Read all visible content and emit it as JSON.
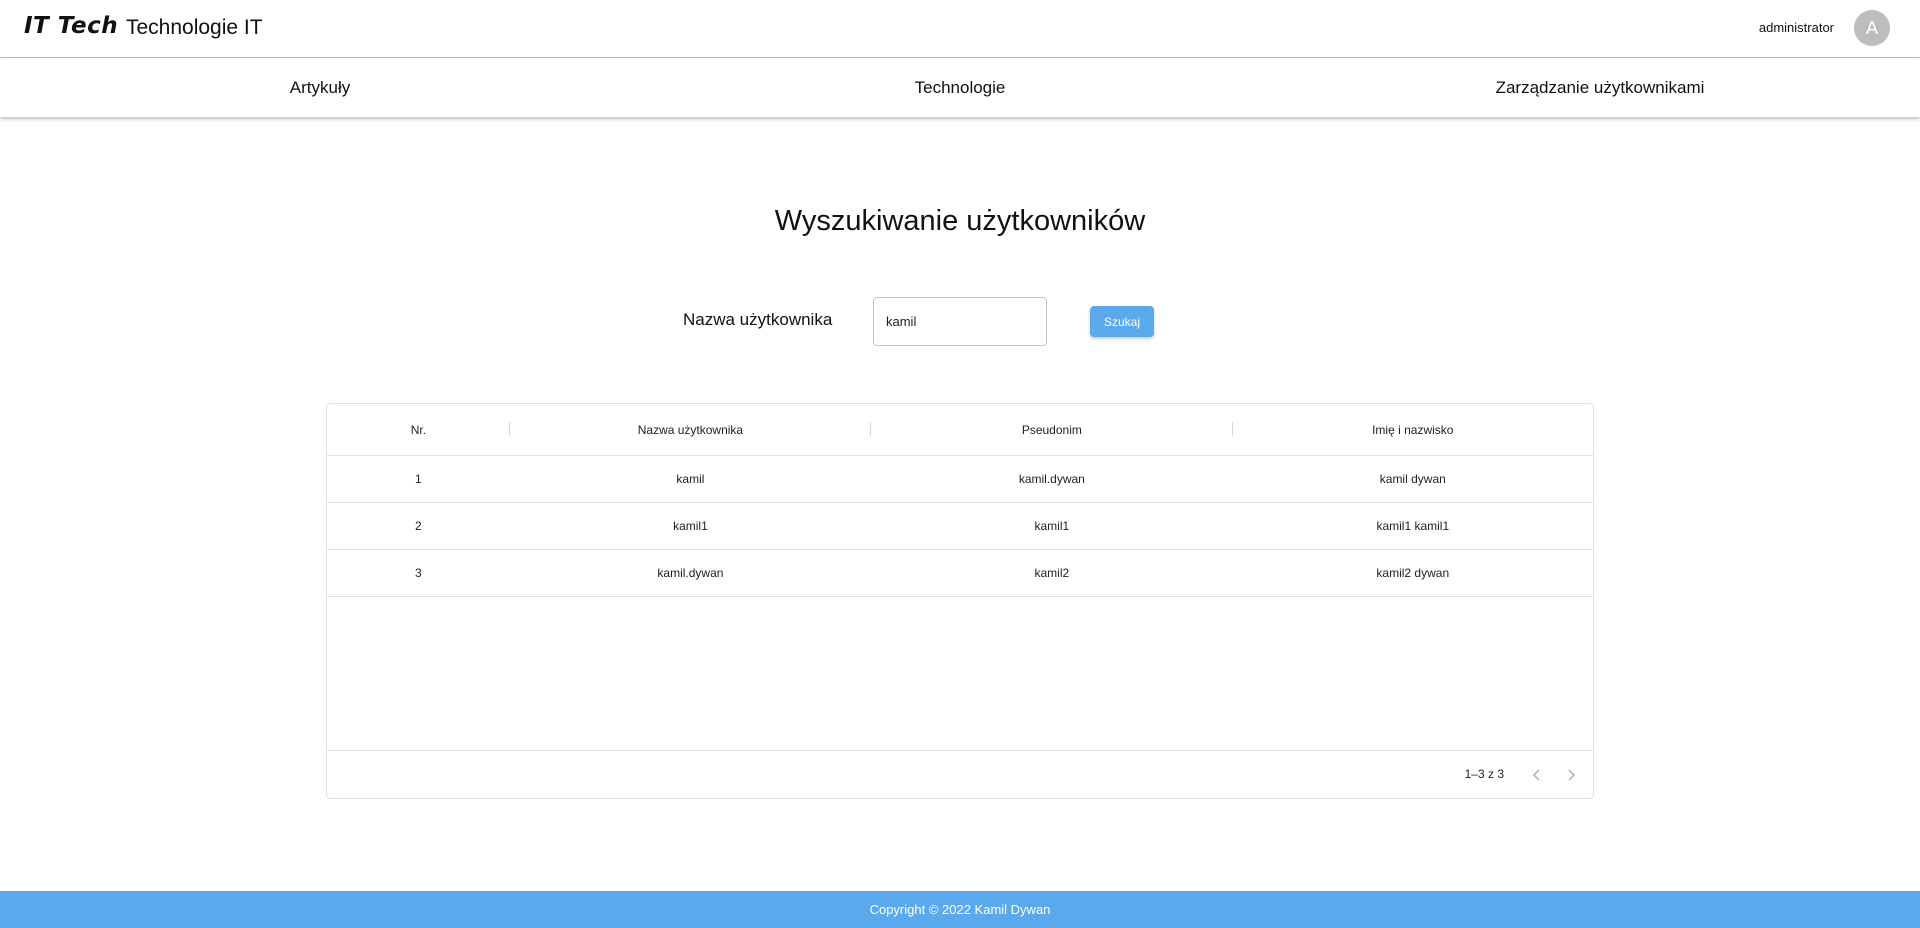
{
  "header": {
    "logo_text": "IT Tech",
    "title": "Technologie IT",
    "username": "administrator",
    "avatar_letter": "A"
  },
  "nav": {
    "items": [
      {
        "label": "Artykuły"
      },
      {
        "label": "Technologie"
      },
      {
        "label": "Zarządzanie użytkownikami"
      }
    ]
  },
  "page": {
    "title": "Wyszukiwanie użytkowników"
  },
  "search": {
    "label": "Nazwa użytkownika",
    "value": "kamil",
    "button_label": "Szukaj"
  },
  "table": {
    "columns": [
      "Nr.",
      "Nazwa użytkownika",
      "Pseudonim",
      "Imię i nazwisko"
    ],
    "rows": [
      [
        "1",
        "kamil",
        "kamil.dywan",
        "kamil dywan"
      ],
      [
        "2",
        "kamil1",
        "kamil1",
        "kamil1 kamil1"
      ],
      [
        "3",
        "kamil.dywan",
        "kamil2",
        "kamil2 dywan"
      ]
    ],
    "pagination": "1–3 z 3"
  },
  "footer": {
    "copyright": "Copyright © 2022 Kamil Dywan"
  },
  "colors": {
    "accent": "#5aa9ec",
    "avatar": "#bdbdbd"
  }
}
